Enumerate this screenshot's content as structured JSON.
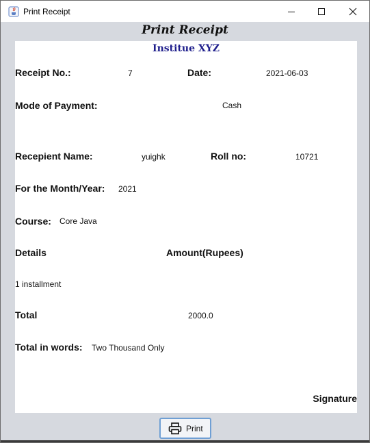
{
  "window": {
    "title": "Print Receipt",
    "icon": "java-app-icon",
    "controls": [
      "minimize-icon",
      "maximize-icon",
      "close-icon"
    ]
  },
  "heading": "Print Receipt",
  "receipt": {
    "institute": "Institue XYZ",
    "receipt_no_label": "Receipt No.:",
    "receipt_no": "7",
    "date_label": "Date:",
    "date": "2021-06-03",
    "mode_label": "Mode of Payment:",
    "mode": "Cash",
    "recipient_label": "Recepient Name:",
    "recipient": "yuighk",
    "roll_label": "Roll no:",
    "roll": "10721",
    "month_year_label": "For the Month/Year:",
    "month_year": "2021",
    "course_label": "Course:",
    "course": "Core Java",
    "details_label": "Details",
    "amount_label": "Amount(Rupees)",
    "detail_item": "1 installment",
    "total_label": "Total",
    "total": "2000.0",
    "words_label": "Total in words:",
    "words": "Two Thousand Only",
    "signature_label": "Signature"
  },
  "print_button": {
    "label": "Print",
    "icon": "printer-icon"
  },
  "colors": {
    "window_bg": "#d6d9df",
    "institute": "#1f1f8c",
    "button_border": "#6f9fd4"
  }
}
